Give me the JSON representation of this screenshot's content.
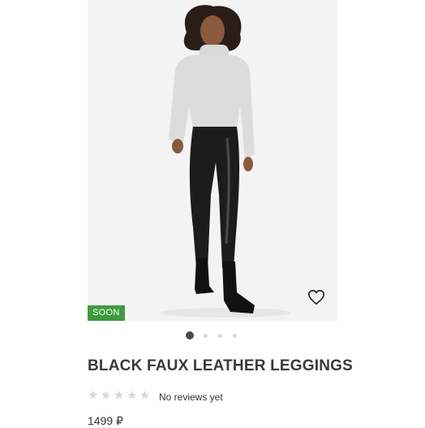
{
  "product": {
    "badge": "SOON",
    "title": "BLACK FAUX LEATHER LEGGINGS",
    "rating": 0,
    "rating_max": 5,
    "reviews_text": "No reviews yet",
    "price": "1499 ₽"
  },
  "gallery": {
    "image_count": 4,
    "active_index": 0
  },
  "icons": {
    "favorite": "heart-outline-icon",
    "rating_star": "star-icon"
  },
  "colors": {
    "badge_bg": "#3f9a3f",
    "star_empty": "#d9d9d9",
    "dot_active": "#4a4a4a",
    "dot_inactive": "#d8d8d8"
  }
}
